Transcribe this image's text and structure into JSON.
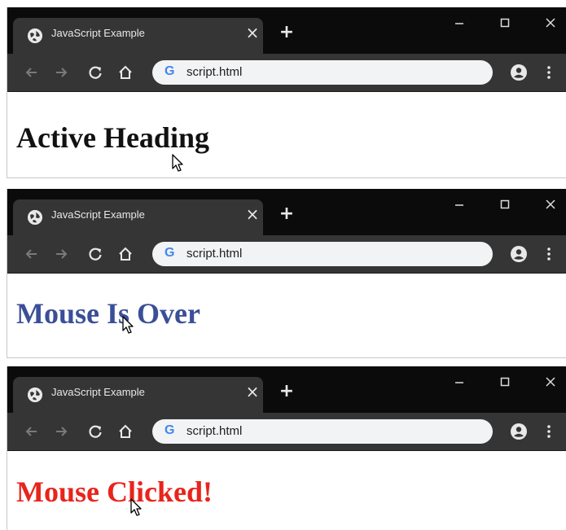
{
  "windows": [
    {
      "tab": {
        "title": "JavaScript Example",
        "close": "×"
      },
      "new_tab": "+",
      "address": {
        "logo": "G",
        "url": "script.html"
      },
      "heading": {
        "text": "Active Heading",
        "color": "#111111"
      }
    },
    {
      "tab": {
        "title": "JavaScript Example",
        "close": "×"
      },
      "new_tab": "+",
      "address": {
        "logo": "G",
        "url": "script.html"
      },
      "heading": {
        "text": "Mouse Is Over",
        "color": "#3a4f98"
      }
    },
    {
      "tab": {
        "title": "JavaScript Example",
        "close": "×"
      },
      "new_tab": "+",
      "address": {
        "logo": "G",
        "url": "script.html"
      },
      "heading": {
        "text": "Mouse Clicked!",
        "color": "#e8241c"
      }
    }
  ],
  "icons": {
    "favicon": "globe-icon",
    "back": "arrow-left-icon",
    "forward": "arrow-right-icon",
    "reload": "reload-icon",
    "home": "home-icon",
    "profile": "profile-icon",
    "menu": "kebab-menu-icon",
    "cursor": "mouse-pointer-icon"
  }
}
